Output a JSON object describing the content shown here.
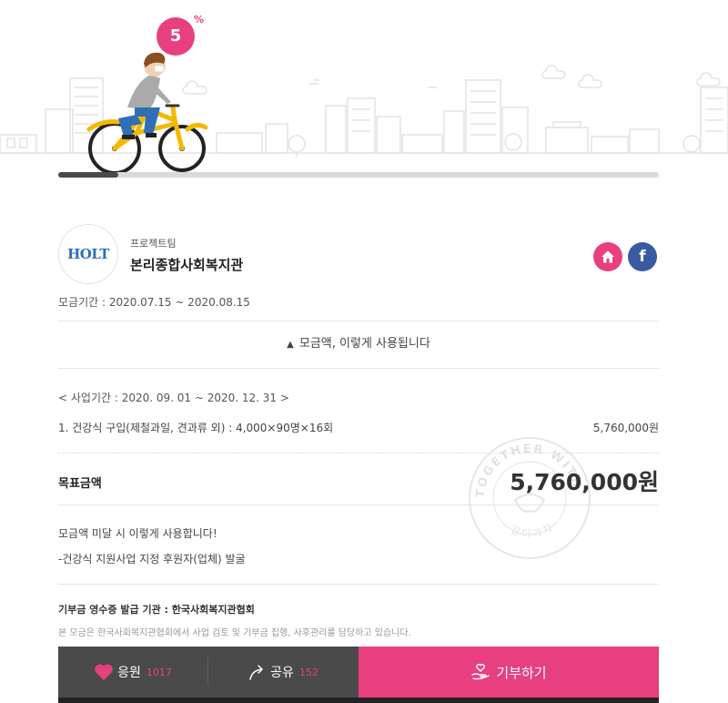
{
  "progress": {
    "percent_value": "5",
    "percent_sign": "%",
    "fraction": 0.1
  },
  "organization": {
    "logo_text": "HOLT",
    "role": "프로젝트팀",
    "name": "본리종합사회복지관"
  },
  "fundraising_period": "모금기간 : 2020.07.15 ~ 2020.08.15",
  "usage_toggle": {
    "arrow": "▲",
    "label": "모금액, 이렇게 사용됩니다"
  },
  "business_period": "< 사업기간 : 2020. 09. 01 ~ 2020. 12. 31 >",
  "items": [
    {
      "description": "1.  건강식 구입(제철과일, 견과류 외) : 4,000×90명×16회",
      "amount": "5,760,000원"
    }
  ],
  "goal": {
    "label": "목표금액",
    "amount": "5,760,000원"
  },
  "stamp_text": "TOGETHER WITH KAKAO 같이가치",
  "shortfall_notes": [
    "모금액 미달 시 이렇게 사용합니다!",
    "-건강식 지원사업 지정 후원자(업체) 발굴"
  ],
  "receipt": {
    "label": "기부금 영수증 발급 기관 : 한국사회복지관협회"
  },
  "disclaimer": "본 모금은 한국사회복지관협회에서 사업 검토 및 기부금 집행, 사후관리를 담당하고 있습니다.",
  "actions": {
    "cheer_label": "응원",
    "cheer_count": "1017",
    "share_label": "공유",
    "share_count": "152",
    "donate_label": "기부하기"
  },
  "icons": {
    "heart": "heart-icon",
    "share": "share-arrow-icon",
    "donate": "hand-heart-icon",
    "home": "home-icon",
    "facebook": "facebook-icon"
  },
  "colors": {
    "accent_pink": "#e8407f",
    "bar_dark": "#4a4a4a",
    "facebook_blue": "#3a5ba0",
    "bike_yellow": "#f5b800"
  }
}
